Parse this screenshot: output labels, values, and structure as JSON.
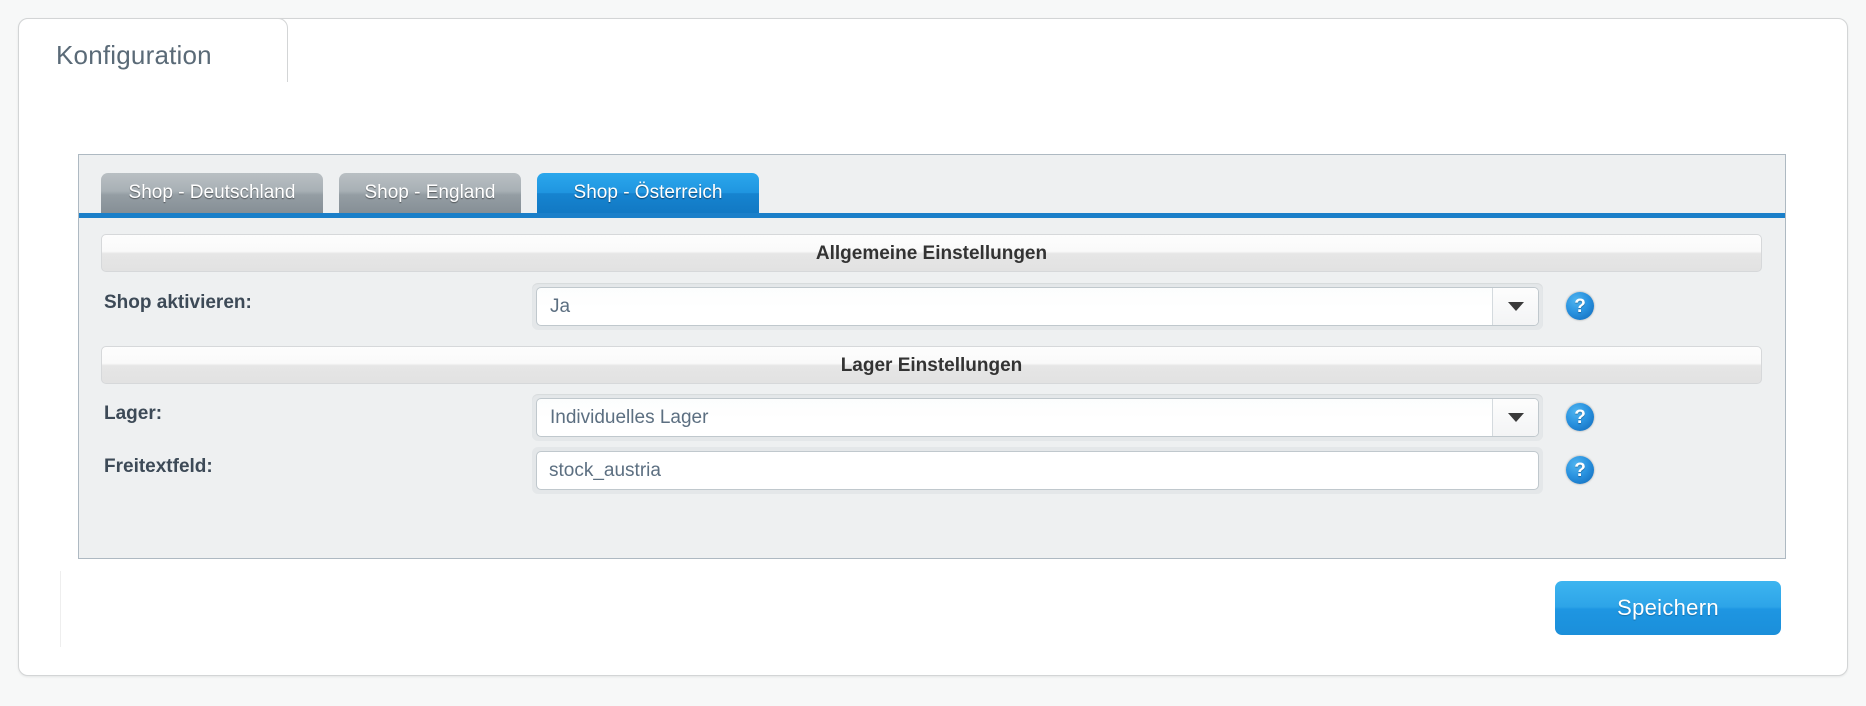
{
  "window": {
    "folder_tab_label": "Konfiguration"
  },
  "shop_tabs": {
    "items": [
      {
        "label": "Shop - Deutschland",
        "active": false
      },
      {
        "label": "Shop - England",
        "active": false
      },
      {
        "label": "Shop - Österreich",
        "active": true
      }
    ]
  },
  "sections": {
    "general": {
      "header": "Allgemeine Einstellungen",
      "shop_active": {
        "label": "Shop aktivieren:",
        "value": "Ja",
        "help": "?"
      }
    },
    "stock": {
      "header": "Lager Einstellungen",
      "warehouse": {
        "label": "Lager:",
        "value": "Individuelles Lager",
        "help": "?"
      },
      "free_text": {
        "label": "Freitextfeld:",
        "value": "stock_austria",
        "placeholder": "stock_austria",
        "help": "?"
      }
    }
  },
  "footer": {
    "save_label": "Speichern"
  },
  "colors": {
    "accent_blue": "#1a7fc9",
    "tab_active_blue": "#1f95e0",
    "save_button_blue": "#2da4e8",
    "panel_bg": "#eef0f1",
    "panel_border": "#aeb9c2",
    "label_text": "#3d4a57",
    "value_text": "#5c6f81",
    "folder_tab_text": "#5a6a77"
  }
}
